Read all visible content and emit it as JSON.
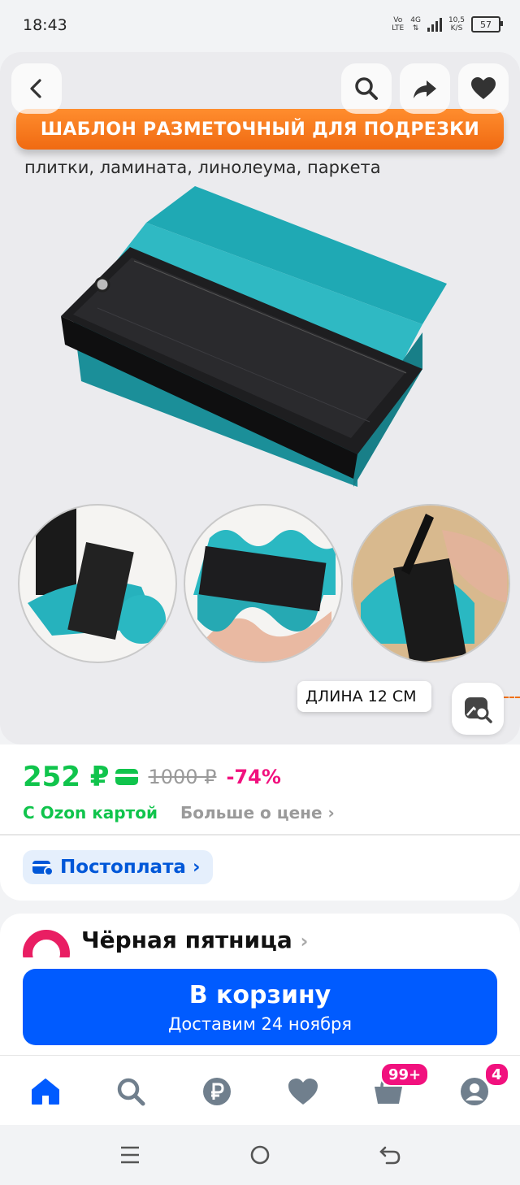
{
  "status_bar": {
    "time": "18:43",
    "volte": "Vo",
    "lte": "LTE",
    "network": "4G",
    "speed_value": "10,5",
    "speed_unit": "K/S",
    "battery": "57"
  },
  "gallery": {
    "banner_text": "ШАБЛОН РАЗМЕТОЧНЫЙ ДЛЯ ПОДРЕЗКИ",
    "subtitle": "плитки, ламината, линолеума, паркета",
    "length_label": "ДЛИНА 12 СМ",
    "icons": [
      "back-icon",
      "search-icon",
      "share-icon",
      "heart-icon",
      "image-search-icon"
    ]
  },
  "price": {
    "current": "252 ₽",
    "old": "1000 ₽",
    "discount": "-74%",
    "ozon_card": "С Ozon картой",
    "more": "Больше о цене",
    "more_arrow": "›"
  },
  "postpay": {
    "label": "Постоплата",
    "arrow": "›"
  },
  "promo": {
    "title": "Чёрная пятница",
    "arrow": "›"
  },
  "cart_button": {
    "label": "В корзину",
    "delivery": "Доставим 24 ноября"
  },
  "tabbar": {
    "cart_badge": "99+",
    "profile_badge": "4",
    "active_color": "#005bff"
  },
  "colors": {
    "accent": "#005bff",
    "green": "#10c44c",
    "pink": "#f1117e",
    "orange": "#f07010"
  }
}
